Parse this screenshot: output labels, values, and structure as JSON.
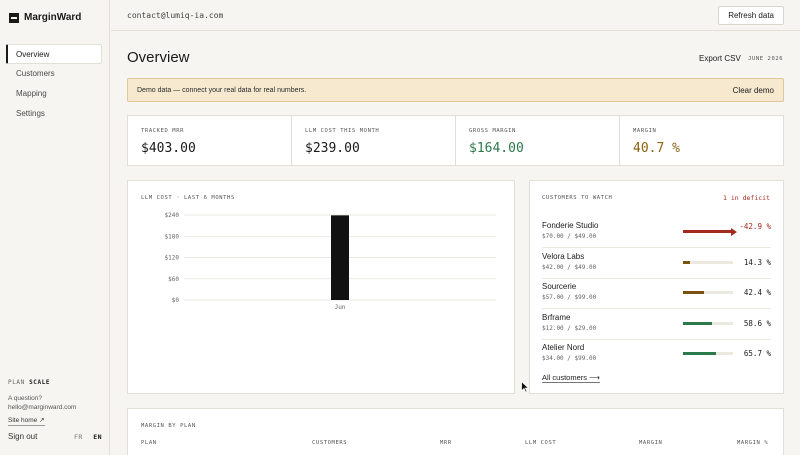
{
  "brand": {
    "name": "MarginWard"
  },
  "sidebar": {
    "items": [
      {
        "label": "Overview",
        "active": true
      },
      {
        "label": "Customers",
        "active": false
      },
      {
        "label": "Mapping",
        "active": false
      },
      {
        "label": "Settings",
        "active": false
      }
    ],
    "plan_label": "PLAN",
    "plan_value": "SCALE",
    "question": "A question?",
    "contact_email": "hello@marginward.com",
    "site_home": "Site home ↗",
    "sign_out": "Sign out",
    "lang_fr": "FR",
    "lang_en": "EN"
  },
  "topbar": {
    "email": "contact@lumiq-ia.com",
    "refresh_label": "Refresh data"
  },
  "page": {
    "title": "Overview",
    "export_label": "Export CSV",
    "month": "JUNE 2026"
  },
  "banner": {
    "text": "Demo data — connect your real data for real numbers.",
    "action": "Clear demo"
  },
  "kpis": [
    {
      "label": "TRACKED MRR",
      "value": "$403.00",
      "color": "#1a1a1a"
    },
    {
      "label": "LLM COST THIS MONTH",
      "value": "$239.00",
      "color": "#1a1a1a"
    },
    {
      "label": "GROSS MARGIN",
      "value": "$164.00",
      "color": "#2c7a4b"
    },
    {
      "label": "MARGIN",
      "value": "40.7 %",
      "color": "#8a6212"
    }
  ],
  "chart_title": "LLM COST · LAST 6 MONTHS",
  "chart_data": {
    "type": "bar",
    "categories": [
      "Jun"
    ],
    "values": [
      239
    ],
    "y_ticks": [
      "$240",
      "$180",
      "$120",
      "$60",
      "$0"
    ],
    "ylim": [
      0,
      240
    ],
    "grid": true,
    "bar_color": "#111111"
  },
  "watch": {
    "title": "CUSTOMERS TO WATCH",
    "deficit": "1 in deficit",
    "rows": [
      {
        "name": "Fonderie Studio",
        "sub": "$70.00 / $49.00",
        "value": "-42.9 %",
        "margin": -42.9,
        "color": "#a32a1c"
      },
      {
        "name": "Velora Labs",
        "sub": "$42.00 / $49.00",
        "value": "14.3 %",
        "margin": 14.3,
        "color": "#7a5210"
      },
      {
        "name": "Sourcerie",
        "sub": "$57.00 / $99.00",
        "value": "42.4 %",
        "margin": 42.4,
        "color": "#7a5210"
      },
      {
        "name": "Brframe",
        "sub": "$12.00 / $29.00",
        "value": "58.6 %",
        "margin": 58.6,
        "color": "#2c7a4b"
      },
      {
        "name": "Atelier Nord",
        "sub": "$34.00 / $99.00",
        "value": "65.7 %",
        "margin": 65.7,
        "color": "#2c7a4b"
      }
    ],
    "all_label": "All customers ⟶"
  },
  "plan_table": {
    "title": "MARGIN BY PLAN",
    "headers": [
      "PLAN",
      "CUSTOMERS",
      "MRR",
      "LLM COST",
      "MARGIN",
      "MARGIN %"
    ]
  }
}
